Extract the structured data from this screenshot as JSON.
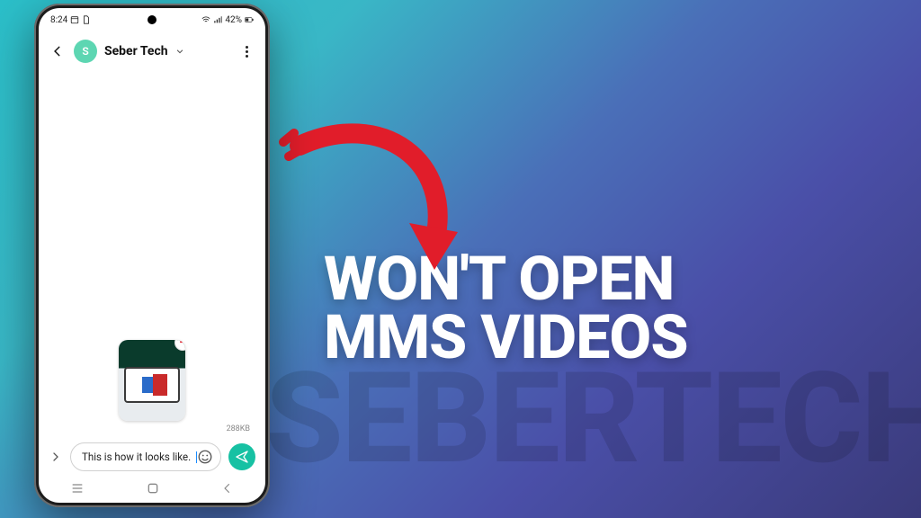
{
  "background_watermark": "SEBERTECH",
  "headline_line1": "WON'T OPEN",
  "headline_line2": "MMS VIDEOS",
  "statusbar": {
    "time": "8:24",
    "battery_text": "42%"
  },
  "chat": {
    "contact_name": "Seber Tech",
    "avatar_initial": "S"
  },
  "attachment": {
    "filesize": "288KB",
    "remove_glyph": "−"
  },
  "composer": {
    "expand_glyph": "›",
    "text": "This is how it looks like."
  },
  "colors": {
    "accent": "#17c1a3",
    "arrow": "#e11d2a"
  }
}
